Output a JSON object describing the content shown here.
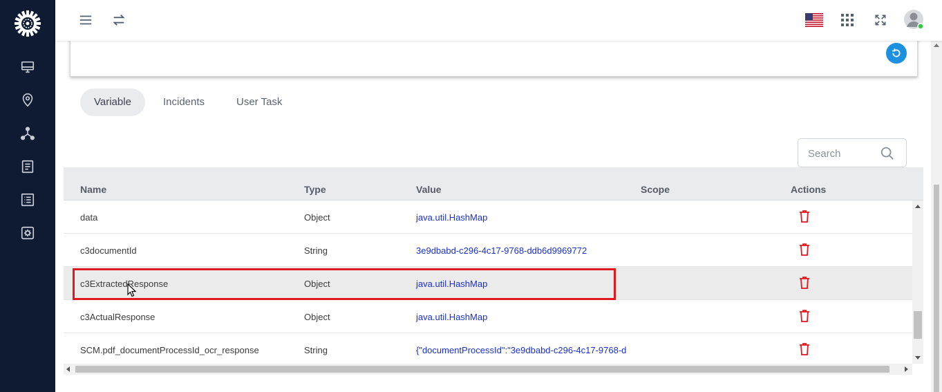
{
  "colors": {
    "sidebar_bg": "#0f1a33",
    "accent": "#1e90e0",
    "link": "#1a2fd6",
    "delete": "#e0191e",
    "highlight_box": "#e0191e"
  },
  "sidebar": {
    "logo": "gear-logo-icon",
    "items": [
      {
        "icon": "monitor-icon"
      },
      {
        "icon": "map-pin-icon"
      },
      {
        "icon": "network-icon"
      },
      {
        "icon": "document-icon"
      },
      {
        "icon": "list-icon"
      },
      {
        "icon": "settings-box-icon"
      }
    ]
  },
  "topbar": {
    "icons": [
      "hamburger-icon",
      "swap-icon",
      "us-flag-icon",
      "apps-grid-icon",
      "fullscreen-icon",
      "avatar-icon"
    ]
  },
  "tabs": [
    {
      "label": "Variable",
      "active": true
    },
    {
      "label": "Incidents",
      "active": false
    },
    {
      "label": "User Task",
      "active": false
    }
  ],
  "search": {
    "placeholder": "Search",
    "value": ""
  },
  "table": {
    "columns": [
      "Name",
      "Type",
      "Value",
      "Scope",
      "Actions"
    ],
    "rows": [
      {
        "name": "data",
        "type": "Object",
        "value": "java.util.HashMap",
        "scope": ""
      },
      {
        "name": "c3documentId",
        "type": "String",
        "value": "3e9dbabd-c296-4c17-9768-ddb6d9969772",
        "scope": ""
      },
      {
        "name": "c3ExtractedResponse",
        "type": "Object",
        "value": "java.util.HashMap",
        "scope": ""
      },
      {
        "name": "c3ActualResponse",
        "type": "Object",
        "value": "java.util.HashMap",
        "scope": ""
      },
      {
        "name": "SCM.pdf_documentProcessId_ocr_response",
        "type": "String",
        "value": "{\"documentProcessId\":\"3e9dbabd-c296-4c17-9768-d",
        "scope": ""
      }
    ]
  }
}
